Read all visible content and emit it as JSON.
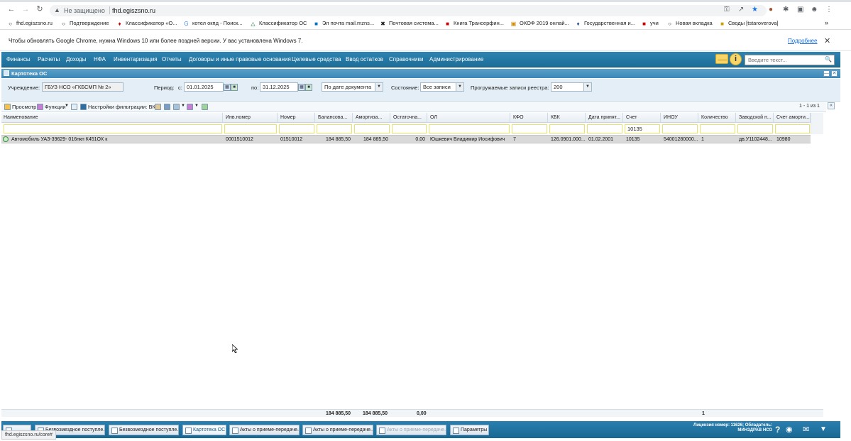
{
  "browser": {
    "security_label": "Не защищено",
    "url": "fhd.egiszsno.ru",
    "bookmarks": [
      "fhd.egiszsno.ru",
      "Подтверждение",
      "Классификатор «О...",
      "котел окпд - Поиск...",
      "Классификатор ОС",
      "Эл почта mail.mzns...",
      "Почтовая система...",
      "Книга Трансерфин...",
      "ОКОФ 2019 онлай...",
      "Государственная и...",
      "учи",
      "Новая вкладка",
      "Своды [tstaroverova]"
    ],
    "more_bookmarks": "»",
    "infobar_text": "Чтобы обновлять Google Chrome, нужна Windows 10 или более поздней версии. У вас установлена Windows 7.",
    "infobar_link": "Подробнее",
    "status_url": "fhd.egiszsno.ru/core#"
  },
  "menu": {
    "items": [
      "Финансы",
      "Расчеты",
      "Доходы",
      "НФА",
      "Инвентаризация",
      "Отчеты",
      "Договоры и иные правовые основания",
      "Целевые средства",
      "Ввод остатков",
      "Справочники",
      "Администрирование"
    ],
    "search_placeholder": "Введите текст..."
  },
  "window": {
    "title": "Картотека ОС"
  },
  "filters": {
    "institution_label": "Учреждение:",
    "institution_value": "ГБУЗ НСО «ГКБСМП № 2»",
    "period_label": "Период:",
    "from_label": "с:",
    "from_value": "01.01.2025",
    "to_label": "по:",
    "to_value": "31.12.2025",
    "date_mode_value": "По дате документа",
    "state_label": "Состояние:",
    "state_value": "Все записи",
    "loaded_label": "Прогружаемые записи реестра:",
    "loaded_value": "200"
  },
  "toolbar": {
    "view_label": "Просмотр",
    "functions_label": "Функции",
    "filter_settings_label": "Настройки фильтрации: ВКЛ",
    "pager": "1 - 1 из 1"
  },
  "grid": {
    "columns": [
      "Наименование",
      "Инв.номер",
      "Номер",
      "Балансова...",
      "Амортиза...",
      "Остаточна...",
      "ОЛ",
      "КФО",
      "КБК",
      "Дата принят...",
      "Счет",
      "ИНОУ",
      "Количество",
      "Заводской н...",
      "Счет аморти..."
    ],
    "filter_account_value": "10135",
    "rows": [
      {
        "name": "Автомобиль УАЗ-39629- 016нкп К451ОХ к",
        "inv": "0001510012",
        "number": "01510012",
        "balance": "184 885,50",
        "amort": "184 885,50",
        "residual": "0,00",
        "ol": "Юшкевич Владимир Иосифович",
        "kfo": "7",
        "kbk": "126.0901.000...",
        "date": "01.02.2001",
        "account": "10135",
        "inou": "54001280000...",
        "qty": "1",
        "serial": "дв.У1102448...",
        "amort_account": "10980"
      }
    ],
    "totals": {
      "balance": "184 885,50",
      "amort": "184 885,50",
      "residual": "0,00",
      "qty": "1"
    }
  },
  "taskbar": {
    "tasks": [
      "",
      "Безвозмездное поступле...",
      "Безвозмездное поступле...",
      "Картотека ОС",
      "Акты о приеме-передаче...",
      "Акты о приеме-передаче...",
      "Акты о приеме-передаче...",
      "Параметры"
    ],
    "license": "Лицензия номер: 11626; Обладатель: МИНЗДРАВ НСО"
  }
}
